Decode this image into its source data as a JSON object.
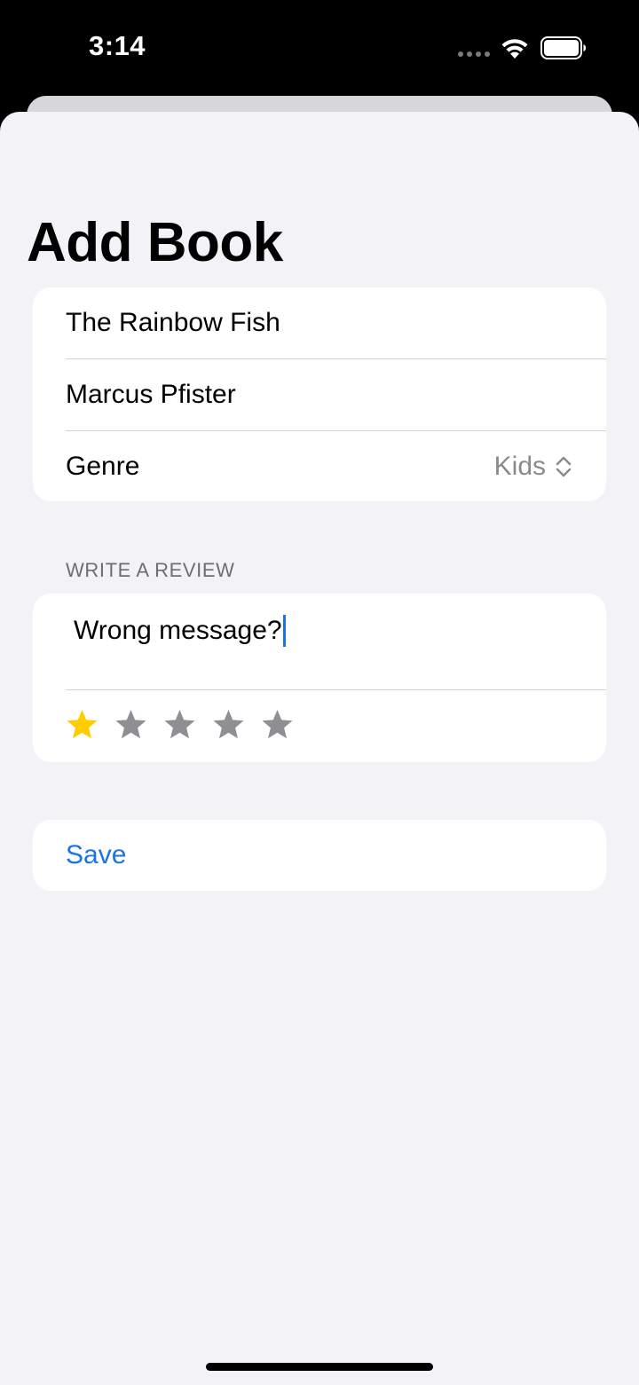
{
  "status_bar": {
    "time": "3:14",
    "icons": [
      "signal-dots-icon",
      "wifi-icon",
      "battery-icon"
    ]
  },
  "page": {
    "title": "Add Book"
  },
  "book_form": {
    "title_value": "The Rainbow Fish",
    "author_value": "Marcus Pfister",
    "genre_label": "Genre",
    "genre_value": "Kids"
  },
  "review_section": {
    "header": "WRITE A REVIEW",
    "review_text": "Wrong message?",
    "rating": 1,
    "max_rating": 5
  },
  "actions": {
    "save_label": "Save"
  },
  "colors": {
    "accent": "#1a73e8",
    "star_active": "#ffcc00",
    "star_inactive": "#8e8e93",
    "background": "#f2f2f7",
    "card": "#ffffff"
  }
}
